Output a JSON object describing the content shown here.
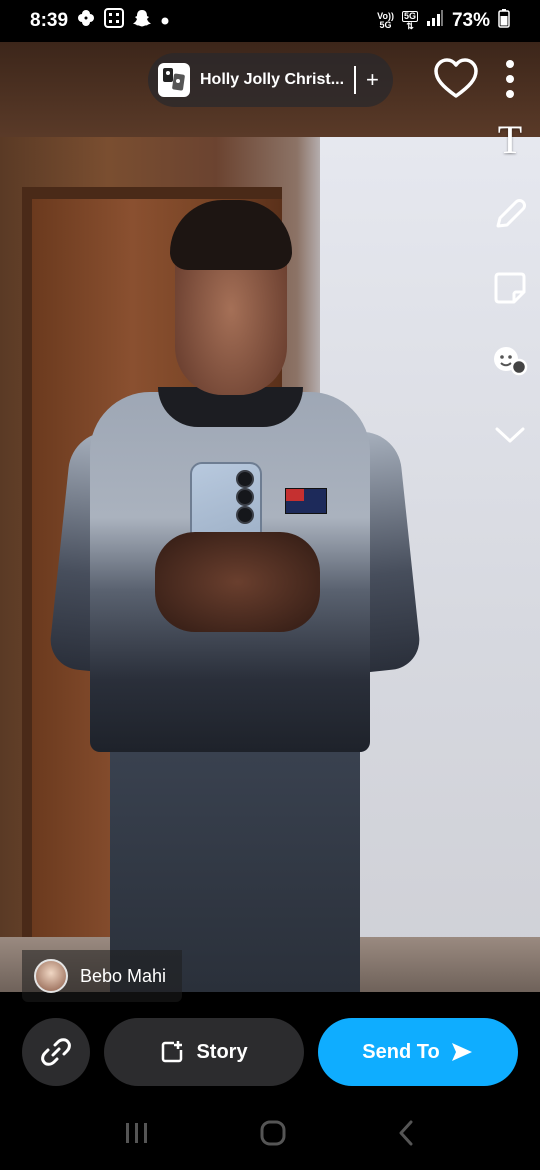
{
  "status_bar": {
    "time": "8:39",
    "network_top": "Vo))",
    "network_bottom": "5G",
    "badge_top": "5G",
    "battery": "73%",
    "icons": [
      "pinwheel-icon",
      "qr-icon",
      "snapchat-ghost-icon",
      "dot-icon",
      "signal-icon",
      "battery-icon"
    ]
  },
  "sound": {
    "title": "Holly Jolly Christ...",
    "add_label": "+"
  },
  "toolbar": {
    "text_tool_label": "T",
    "icons": [
      "heart-icon",
      "more-icon",
      "text-icon",
      "pencil-icon",
      "sticker-icon",
      "lens-icon",
      "chevron-down-icon"
    ]
  },
  "user": {
    "name": "Bebo Mahi"
  },
  "actions": {
    "story_label": "Story",
    "send_label": "Send To"
  },
  "colors": {
    "send_button": "#0fadff",
    "dark_button": "#2c2c2e"
  }
}
